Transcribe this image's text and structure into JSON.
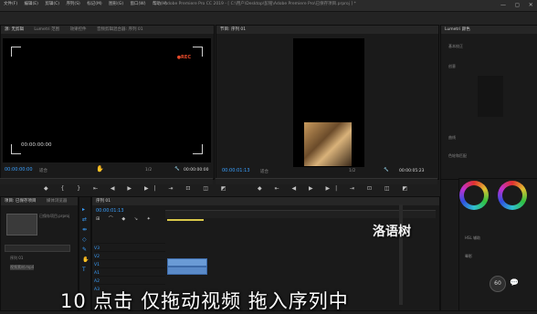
{
  "app": {
    "title": "Adobe Premiere Pro CC 2019 - [ C:\\用户\\Desktop\\彭铭\\Adobe Premiere Pro\\已保存项目.prproj ] *",
    "menu": [
      "文件(F)",
      "编辑(E)",
      "剪辑(C)",
      "序列(S)",
      "标记(M)",
      "图形(G)",
      "窗口(W)",
      "帮助(H)"
    ],
    "window_buttons": "— ◻ ✕"
  },
  "source_monitor": {
    "tabs": [
      "源: 无剪辑",
      "Lumetri 范围",
      "效果控件",
      "音频剪辑混合器: 序列 01"
    ],
    "rec_label": "●REC",
    "screen_timecode": "00:00:00:00",
    "timecode_in": "00:00:00:00",
    "fit_label": "适合",
    "page_label": "1/2",
    "timecode_out": "00:00:00:00"
  },
  "program_monitor": {
    "tabs": [
      "节目: 序列 01"
    ],
    "timecode_in": "00:00:01:13",
    "fit_label": "适合",
    "page_label": "1/2",
    "timecode_out": "00:00:05:23"
  },
  "lumetri": {
    "tab": "Lumetri 颜色",
    "labels": [
      "基本校正",
      "创意",
      "曲线",
      "色轮和匹配",
      "HSL 辅助",
      "晕影"
    ]
  },
  "project_panel": {
    "tabs": [
      "项目: 已保存项目",
      "媒体浏览器"
    ],
    "items": [
      "已保存项目.prproj",
      "序列 01",
      "视频素材.mp4"
    ]
  },
  "timeline": {
    "tab": "序列 01",
    "timecode": "00:00:01:13",
    "tracks": [
      "V3",
      "V2",
      "V1",
      "A1",
      "A2",
      "A3"
    ],
    "clip_label": "视频素材.mp4"
  },
  "overlay": {
    "watermark": "洛语树",
    "subtitle": "10 点击 仅拖动视频 拖入序列中",
    "badge": "60"
  }
}
